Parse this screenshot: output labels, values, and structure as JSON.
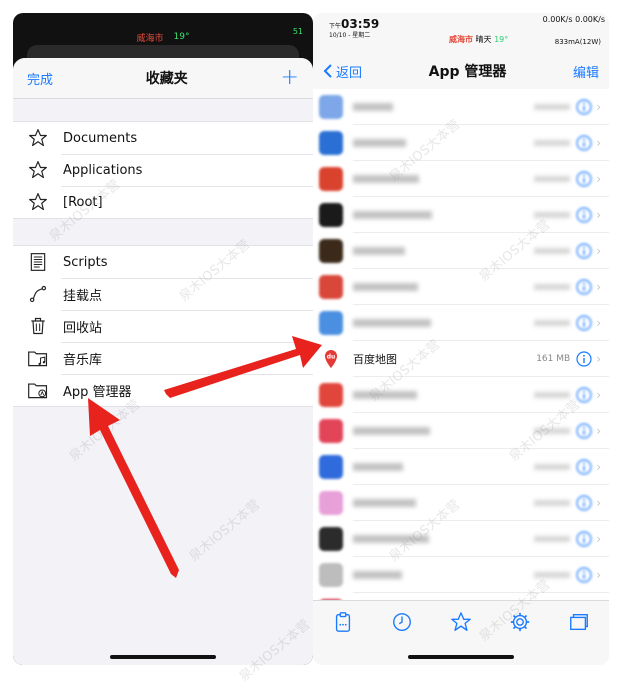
{
  "left": {
    "status": {
      "city": "威海市",
      "temp": "19°",
      "battery": "51"
    },
    "navbar": {
      "done": "完成",
      "title": "收藏夹",
      "add": "+"
    },
    "favorites": [
      {
        "label": "Documents",
        "icon": "star-icon"
      },
      {
        "label": "Applications",
        "icon": "star-icon"
      },
      {
        "label": "[Root]",
        "icon": "star-icon"
      }
    ],
    "places": [
      {
        "label": "Scripts",
        "icon": "scripts-icon"
      },
      {
        "label": "挂载点",
        "icon": "mount-icon"
      },
      {
        "label": "回收站",
        "icon": "trash-icon"
      },
      {
        "label": "音乐库",
        "icon": "music-folder-icon"
      },
      {
        "label": "App 管理器",
        "icon": "app-manager-folder-icon"
      }
    ]
  },
  "right": {
    "status": {
      "time": "03:59",
      "prefix": "下午",
      "date": "10/10 - 星期二",
      "city": "威海市",
      "weather": "晴天",
      "temp": "19°",
      "net": "0.00K/s 0.00K/s",
      "battery_info": "833mA(12W)"
    },
    "navbar": {
      "back": "返回",
      "title": "App 管理器",
      "edit": "编辑"
    },
    "apps": [
      {
        "name": "",
        "size": "",
        "color": "#7da7e8",
        "blurred": true
      },
      {
        "name": "",
        "size": "",
        "color": "#2a6fd4",
        "blurred": true
      },
      {
        "name": "",
        "size": "",
        "color": "#d9432e",
        "blurred": true
      },
      {
        "name": "",
        "size": "",
        "color": "#1a1a1a",
        "blurred": true
      },
      {
        "name": "",
        "size": "",
        "color": "#3b2a1a",
        "blurred": true
      },
      {
        "name": "",
        "size": "",
        "color": "#d8473a",
        "blurred": true
      },
      {
        "name": "",
        "size": "",
        "color": "#4a8fe0",
        "blurred": true
      },
      {
        "name": "百度地图",
        "size": "161 MB",
        "color": "#ffffff",
        "blurred": false
      },
      {
        "name": "",
        "size": "",
        "color": "#e0463c",
        "blurred": true
      },
      {
        "name": "",
        "size": "",
        "color": "#e24458",
        "blurred": true
      },
      {
        "name": "",
        "size": "",
        "color": "#2f6bdc",
        "blurred": true
      },
      {
        "name": "",
        "size": "",
        "color": "#e8a0d8",
        "blurred": true
      },
      {
        "name": "",
        "size": "",
        "color": "#2b2b2b",
        "blurred": true
      },
      {
        "name": "",
        "size": "",
        "color": "#bdbdbd",
        "blurred": true
      },
      {
        "name": "",
        "size": "",
        "color": "#d43a4a",
        "blurred": true
      }
    ],
    "tabs": [
      "clipboard-icon",
      "clock-icon",
      "star-tab-icon",
      "gear-icon",
      "windows-icon"
    ]
  },
  "watermark": "泉木IOS大本营",
  "colors": {
    "accent": "#1a7bff",
    "arrow": "#e8221c"
  }
}
